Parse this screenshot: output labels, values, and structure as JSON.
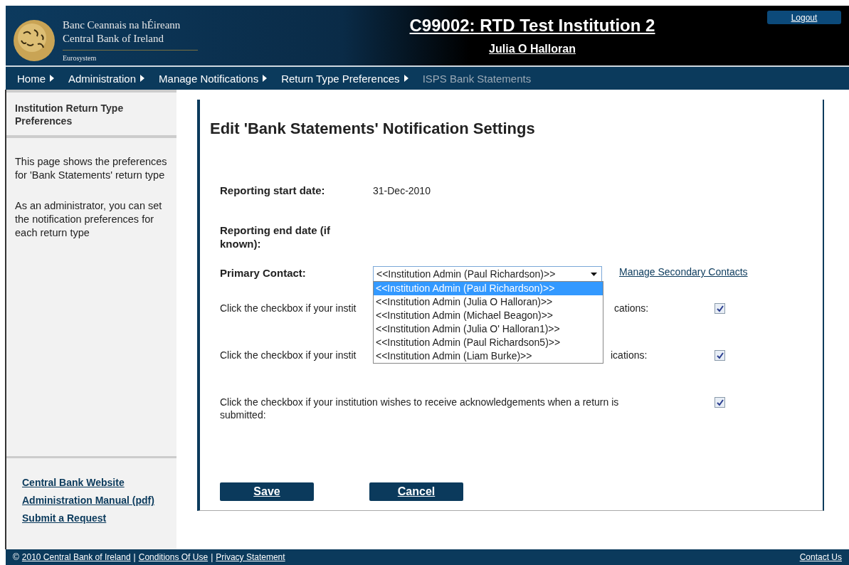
{
  "header": {
    "logo_lines": [
      "Banc Ceannais na hÉireann",
      "Central Bank of Ireland"
    ],
    "logo_sub": "Eurosystem",
    "institution": "C99002: RTD Test Institution 2",
    "user": "Julia O Halloran",
    "logout": "Logout"
  },
  "breadcrumb": [
    {
      "label": "Home",
      "current": false
    },
    {
      "label": "Administration",
      "current": false
    },
    {
      "label": "Manage Notifications",
      "current": false
    },
    {
      "label": "Return Type Preferences",
      "current": false
    },
    {
      "label": "ISPS Bank Statements",
      "current": true
    }
  ],
  "sidebar": {
    "title": "Institution Return Type Preferences",
    "paragraphs": [
      "This page shows the preferences for 'Bank Statements' return type",
      "As an administrator, you can set the notification preferences for each return type"
    ],
    "links": [
      "Central Bank Website",
      "Administration Manual (pdf)",
      "Submit a Request"
    ]
  },
  "form": {
    "title": "Edit 'Bank Statements' Notification Settings",
    "start_label": "Reporting start date:",
    "start_value": "31-Dec-2010",
    "end_label": "Reporting end date (if known):",
    "contact_label": "Primary Contact:",
    "contact_value": "<<Institution Admin (Paul Richardson)>>",
    "secondary_link": "Manage Secondary Contacts",
    "dropdown_open": true,
    "options": [
      {
        "label": "<<Institution Admin (Paul Richardson)>>",
        "selected": true
      },
      {
        "label": "<<Institution Admin (Julia O Halloran)>>",
        "selected": false
      },
      {
        "label": "<<Institution Admin (Michael Beagon)>>",
        "selected": false
      },
      {
        "label": "<<Institution Admin (Julia O' Halloran1)>>",
        "selected": false
      },
      {
        "label": "<<Institution Admin (Paul Richardson5)>>",
        "selected": false
      },
      {
        "label": "<<Institution Admin (Liam Burke)>>",
        "selected": false
      }
    ],
    "checks": [
      {
        "text_start": "Click the checkbox if your instit",
        "text_end": "cations:",
        "checked": true
      },
      {
        "text_start": "Click the checkbox if your instit",
        "text_end": "ications:",
        "checked": true
      },
      {
        "text": "Click the checkbox if your institution wishes to receive acknowledgements when a return is submitted:",
        "checked": true
      }
    ],
    "buttons": [
      "Save",
      "Cancel"
    ]
  },
  "footer": {
    "copyright": "©",
    "links": [
      "2010 Central Bank of Ireland",
      "Conditions Of Use",
      "Privacy Statement"
    ],
    "separator": "|",
    "contact": "Contact Us"
  }
}
